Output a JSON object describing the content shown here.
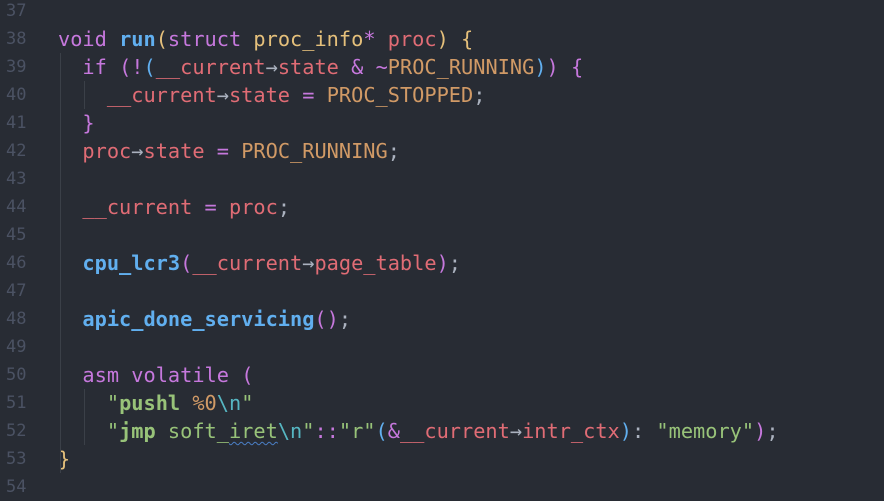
{
  "theme": {
    "background": "#282c34",
    "line_number": "#4b5263",
    "keyword": "#c678dd",
    "function": "#61afef",
    "type": "#e5c07b",
    "variable": "#e06c75",
    "constant": "#d19a66",
    "string": "#98c379",
    "escape": "#56b6c2",
    "operator": "#c678dd",
    "punctuation": "#abb2bf",
    "bracket_1": "#e5c07b",
    "bracket_2": "#c678dd",
    "bracket_3": "#61afef",
    "plain": "#abb2bf"
  },
  "lines": [
    {
      "num": "37",
      "indent": 0,
      "tokens": []
    },
    {
      "num": "38",
      "indent": 0,
      "tokens": [
        {
          "t": "void",
          "c": "keyword"
        },
        {
          "t": " ",
          "c": "plain"
        },
        {
          "t": "run",
          "c": "function",
          "b": true
        },
        {
          "t": "(",
          "c": "bracket_1"
        },
        {
          "t": "struct",
          "c": "keyword"
        },
        {
          "t": " ",
          "c": "plain"
        },
        {
          "t": "proc_info",
          "c": "type"
        },
        {
          "t": "*",
          "c": "keyword"
        },
        {
          "t": " ",
          "c": "plain"
        },
        {
          "t": "proc",
          "c": "variable"
        },
        {
          "t": ")",
          "c": "bracket_1"
        },
        {
          "t": " ",
          "c": "plain"
        },
        {
          "t": "{",
          "c": "bracket_1"
        }
      ]
    },
    {
      "num": "39",
      "indent": 2,
      "tokens": [
        {
          "t": "if",
          "c": "keyword"
        },
        {
          "t": " ",
          "c": "plain"
        },
        {
          "t": "(",
          "c": "bracket_2"
        },
        {
          "t": "!",
          "c": "operator"
        },
        {
          "t": "(",
          "c": "bracket_3"
        },
        {
          "t": "__current",
          "c": "variable"
        },
        {
          "t": "→",
          "c": "plain"
        },
        {
          "t": "state",
          "c": "variable"
        },
        {
          "t": " ",
          "c": "plain"
        },
        {
          "t": "&",
          "c": "keyword"
        },
        {
          "t": " ",
          "c": "plain"
        },
        {
          "t": "~",
          "c": "keyword"
        },
        {
          "t": "PROC_RUNNING",
          "c": "constant"
        },
        {
          "t": ")",
          "c": "bracket_3"
        },
        {
          "t": ")",
          "c": "bracket_2"
        },
        {
          "t": " ",
          "c": "plain"
        },
        {
          "t": "{",
          "c": "bracket_2"
        }
      ]
    },
    {
      "num": "40",
      "indent": 4,
      "tokens": [
        {
          "t": "__current",
          "c": "variable"
        },
        {
          "t": "→",
          "c": "plain"
        },
        {
          "t": "state",
          "c": "variable"
        },
        {
          "t": " ",
          "c": "plain"
        },
        {
          "t": "=",
          "c": "keyword"
        },
        {
          "t": " ",
          "c": "plain"
        },
        {
          "t": "PROC_STOPPED",
          "c": "constant"
        },
        {
          "t": ";",
          "c": "punctuation"
        }
      ]
    },
    {
      "num": "41",
      "indent": 2,
      "tokens": [
        {
          "t": "}",
          "c": "bracket_2"
        }
      ]
    },
    {
      "num": "42",
      "indent": 2,
      "tokens": [
        {
          "t": "proc",
          "c": "variable"
        },
        {
          "t": "→",
          "c": "plain"
        },
        {
          "t": "state",
          "c": "variable"
        },
        {
          "t": " ",
          "c": "plain"
        },
        {
          "t": "=",
          "c": "keyword"
        },
        {
          "t": " ",
          "c": "plain"
        },
        {
          "t": "PROC_RUNNING",
          "c": "constant"
        },
        {
          "t": ";",
          "c": "punctuation"
        }
      ]
    },
    {
      "num": "43",
      "indent": 0,
      "tokens": []
    },
    {
      "num": "44",
      "indent": 2,
      "tokens": [
        {
          "t": "__current",
          "c": "variable"
        },
        {
          "t": " ",
          "c": "plain"
        },
        {
          "t": "=",
          "c": "keyword"
        },
        {
          "t": " ",
          "c": "plain"
        },
        {
          "t": "proc",
          "c": "variable"
        },
        {
          "t": ";",
          "c": "punctuation"
        }
      ]
    },
    {
      "num": "45",
      "indent": 0,
      "tokens": []
    },
    {
      "num": "46",
      "indent": 2,
      "tokens": [
        {
          "t": "cpu_lcr3",
          "c": "function",
          "b": true
        },
        {
          "t": "(",
          "c": "bracket_2"
        },
        {
          "t": "__current",
          "c": "variable"
        },
        {
          "t": "→",
          "c": "plain"
        },
        {
          "t": "page_table",
          "c": "variable"
        },
        {
          "t": ")",
          "c": "bracket_2"
        },
        {
          "t": ";",
          "c": "punctuation"
        }
      ]
    },
    {
      "num": "47",
      "indent": 0,
      "tokens": []
    },
    {
      "num": "48",
      "indent": 2,
      "tokens": [
        {
          "t": "apic_done_servicing",
          "c": "function",
          "b": true
        },
        {
          "t": "()",
          "c": "bracket_2"
        },
        {
          "t": ";",
          "c": "punctuation"
        }
      ]
    },
    {
      "num": "49",
      "indent": 0,
      "tokens": []
    },
    {
      "num": "50",
      "indent": 2,
      "tokens": [
        {
          "t": "asm",
          "c": "keyword"
        },
        {
          "t": " ",
          "c": "plain"
        },
        {
          "t": "volatile",
          "c": "keyword"
        },
        {
          "t": " ",
          "c": "plain"
        },
        {
          "t": "(",
          "c": "bracket_2"
        }
      ]
    },
    {
      "num": "51",
      "indent": 4,
      "tokens": [
        {
          "t": "\"",
          "c": "string"
        },
        {
          "t": "pushl",
          "c": "string",
          "b": true
        },
        {
          "t": " ",
          "c": "string"
        },
        {
          "t": "%0",
          "c": "constant"
        },
        {
          "t": "\\n",
          "c": "escape"
        },
        {
          "t": "\"",
          "c": "string"
        }
      ]
    },
    {
      "num": "52",
      "indent": 4,
      "tokens": [
        {
          "t": "\"",
          "c": "string"
        },
        {
          "t": "jmp",
          "c": "string",
          "b": true
        },
        {
          "t": " soft_",
          "c": "string"
        },
        {
          "t": "iret",
          "c": "string",
          "sq": true
        },
        {
          "t": "\\n",
          "c": "escape"
        },
        {
          "t": "\"",
          "c": "string"
        },
        {
          "t": "::",
          "c": "keyword"
        },
        {
          "t": "\"r\"",
          "c": "string"
        },
        {
          "t": "(",
          "c": "bracket_3"
        },
        {
          "t": "&",
          "c": "keyword"
        },
        {
          "t": "__current",
          "c": "variable"
        },
        {
          "t": "→",
          "c": "plain"
        },
        {
          "t": "intr_ctx",
          "c": "variable"
        },
        {
          "t": ")",
          "c": "bracket_3"
        },
        {
          "t": ":",
          "c": "punctuation"
        },
        {
          "t": " ",
          "c": "plain"
        },
        {
          "t": "\"memory\"",
          "c": "string"
        },
        {
          "t": ")",
          "c": "bracket_2"
        },
        {
          "t": ";",
          "c": "punctuation"
        }
      ]
    },
    {
      "num": "53",
      "indent": 0,
      "tokens": [
        {
          "t": "}",
          "c": "bracket_1"
        }
      ]
    },
    {
      "num": "54",
      "indent": 0,
      "tokens": []
    }
  ]
}
